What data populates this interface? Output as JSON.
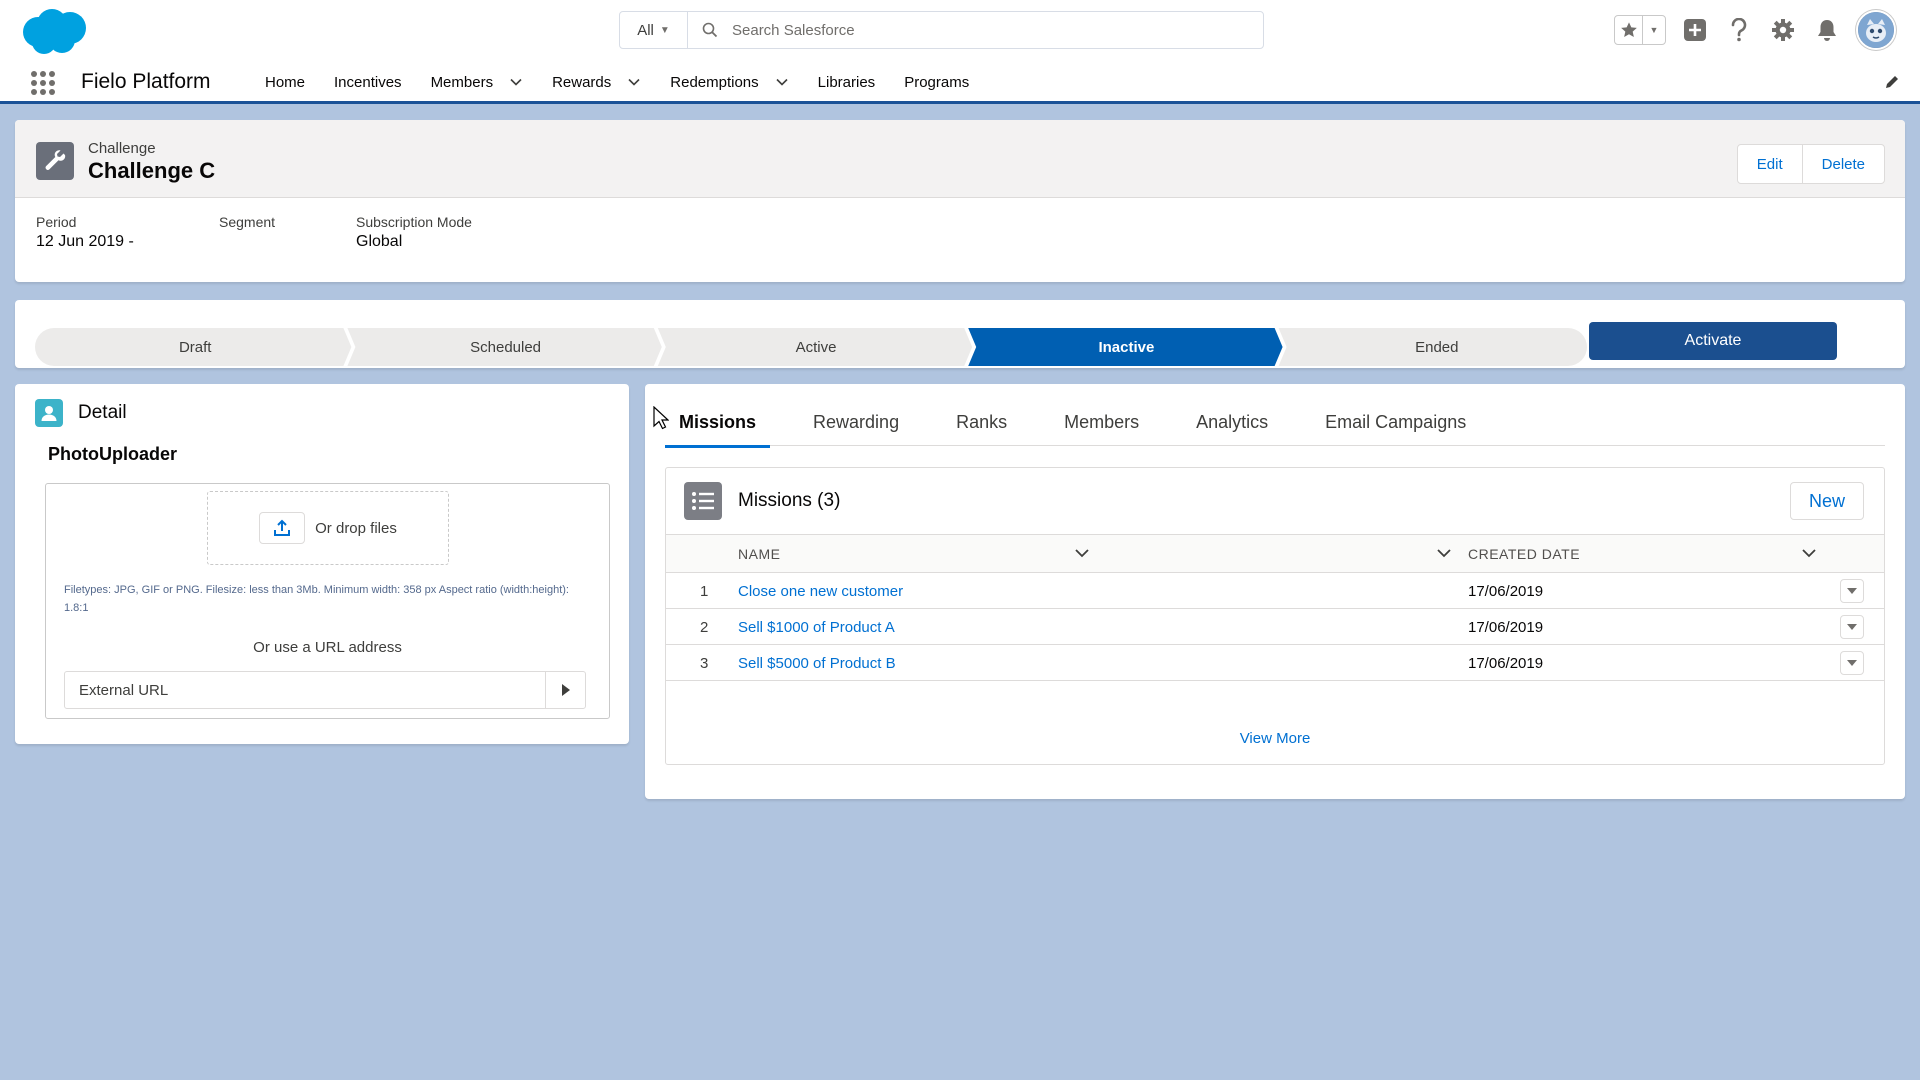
{
  "header": {
    "search_scope": "All",
    "search_placeholder": "Search Salesforce"
  },
  "nav": {
    "app_name": "Fielo Platform",
    "items": [
      {
        "label": "Home",
        "has_menu": false
      },
      {
        "label": "Incentives",
        "has_menu": false
      },
      {
        "label": "Members",
        "has_menu": true
      },
      {
        "label": "Rewards",
        "has_menu": true
      },
      {
        "label": "Redemptions",
        "has_menu": true
      },
      {
        "label": "Libraries",
        "has_menu": false
      },
      {
        "label": "Programs",
        "has_menu": false
      }
    ]
  },
  "record": {
    "object_label": "Challenge",
    "title": "Challenge C",
    "actions": {
      "edit": "Edit",
      "delete": "Delete"
    },
    "fields": [
      {
        "label": "Period",
        "value": "12 Jun 2019 -"
      },
      {
        "label": "Segment",
        "value": ""
      },
      {
        "label": "Subscription Mode",
        "value": "Global"
      }
    ]
  },
  "path": {
    "stages": [
      "Draft",
      "Scheduled",
      "Active",
      "Inactive",
      "Ended"
    ],
    "current_stage": "Inactive",
    "action_label": "Activate",
    "colors": {
      "current": "#005fb2",
      "inactive": "#ecebea"
    }
  },
  "detail": {
    "title": "Detail",
    "subtitle": "PhotoUploader",
    "drop_label": "Or drop files",
    "filetypes_note": "Filetypes: JPG, GIF or PNG. Filesize: less than 3Mb. Minimum width: 358 px Aspect ratio (width:height): 1.8:1",
    "or_url_label": "Or use a URL address",
    "url_placeholder": "External URL"
  },
  "tabs": {
    "items": [
      "Missions",
      "Rewarding",
      "Ranks",
      "Members",
      "Analytics",
      "Email Campaigns"
    ],
    "active": "Missions"
  },
  "missions": {
    "title": "Missions (3)",
    "new_label": "New",
    "columns": {
      "name": "NAME",
      "created": "CREATED DATE"
    },
    "rows": [
      {
        "num": "1",
        "name": "Close one new customer",
        "created": "17/06/2019"
      },
      {
        "num": "2",
        "name": "Sell $1000 of Product A",
        "created": "17/06/2019"
      },
      {
        "num": "3",
        "name": "Sell $5000 of Product B",
        "created": "17/06/2019"
      }
    ],
    "view_more": "View More"
  }
}
